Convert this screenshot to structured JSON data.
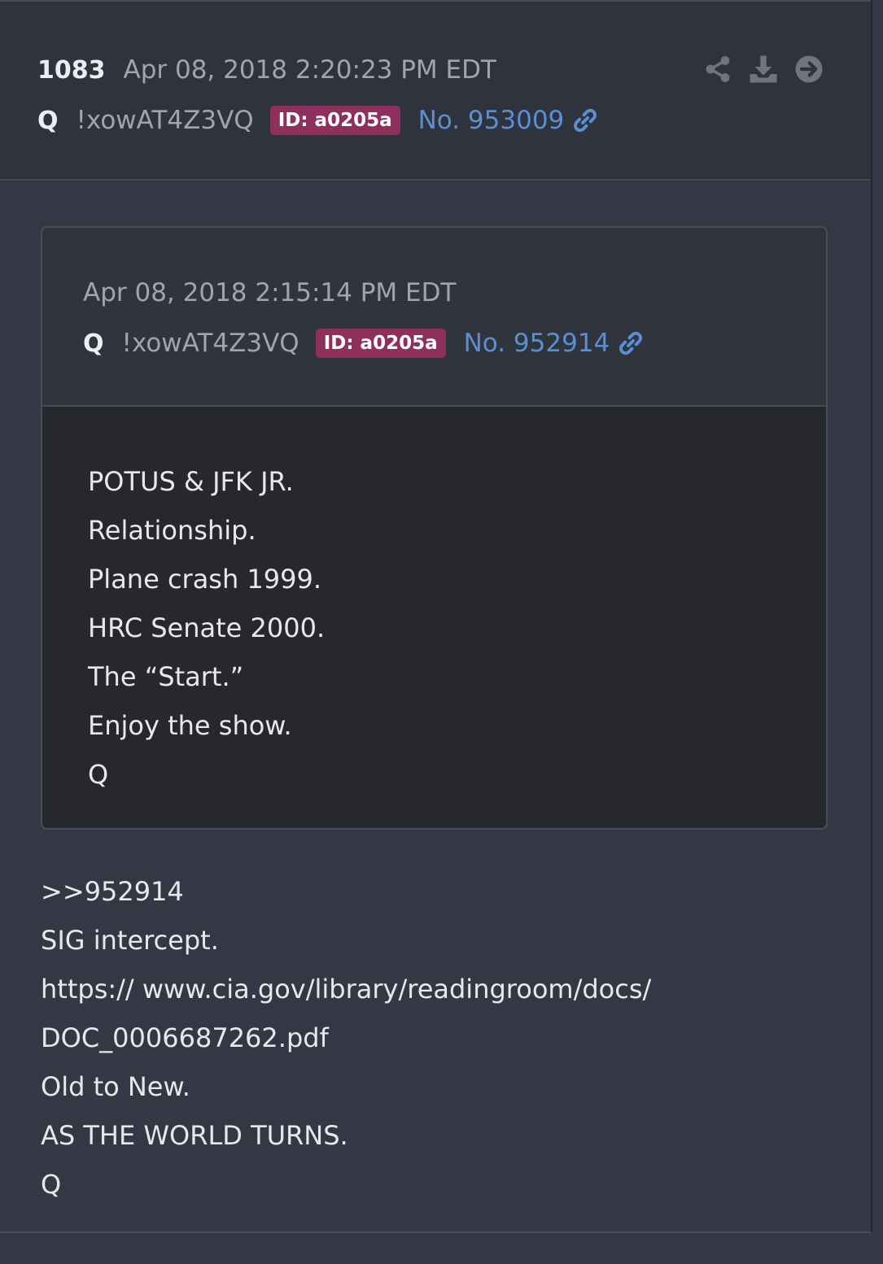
{
  "post": {
    "number": "1083",
    "timestamp": "Apr 08, 2018 2:20:23 PM EDT",
    "author": "Q",
    "tripcode": "!xowAT4Z3VQ",
    "id_badge": "ID: a0205a",
    "post_link": "No. 953009",
    "actions": {
      "share_icon": "share-icon",
      "download_icon": "download-icon",
      "navigate_icon": "arrow-right-circle-icon"
    },
    "colors": {
      "badge": "#8e2f5e",
      "link": "#5a8fd1",
      "background": "#343844"
    }
  },
  "quoted": {
    "timestamp": "Apr 08, 2018 2:15:14 PM EDT",
    "author": "Q",
    "tripcode": "!xowAT4Z3VQ",
    "id_badge": "ID: a0205a",
    "post_link": "No. 952914",
    "lines": [
      "POTUS & JFK JR.",
      "Relationship.",
      "Plane crash 1999.",
      "HRC Senate 2000.",
      "The “Start.”",
      "Enjoy the show.",
      "Q"
    ]
  },
  "body": {
    "lines": [
      ">>952914",
      "SIG intercept.",
      "https:// www.cia.gov/library/readingroom/docs/",
      "DOC_0006687262.pdf",
      "Old to New.",
      "AS THE WORLD TURNS.",
      "Q"
    ]
  }
}
